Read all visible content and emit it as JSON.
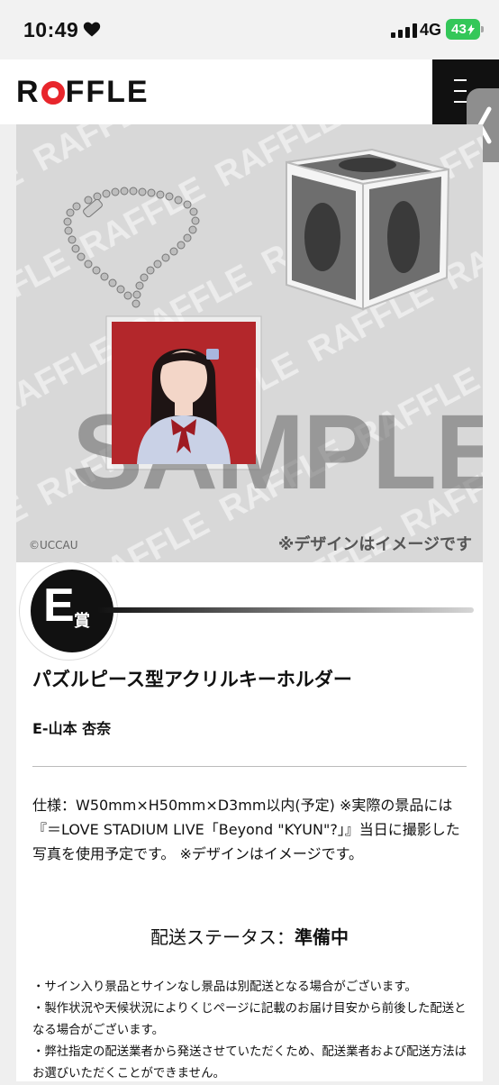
{
  "status_bar": {
    "time": "10:49",
    "network": "4G",
    "battery": "43"
  },
  "header": {
    "logo_before": "R",
    "logo_after": "FFLE"
  },
  "hero": {
    "watermark_text": "SAMPLE",
    "background_word": "RAFFLE",
    "copyright": "©UCCAU",
    "image_note": "※デザインはイメージです"
  },
  "prize": {
    "grade_letter": "E",
    "grade_suffix": "賞",
    "title": "パズルピース型アクリルキーホルダー",
    "member": "E-山本 杏奈",
    "spec": "仕様：W50mm×H50mm×D3mm以内(予定) ※実際の景品には『＝LOVE STADIUM LIVE「Beyond \"KYUN\"?」』当日に撮影した写真を使用予定です。 ※デザインはイメージです。",
    "shipping_label": "配送ステータス：",
    "shipping_value": "準備中",
    "notes": [
      "・サイン入り景品とサインなし景品は別配送となる場合がございます。",
      "・製作状況や天候状況によりくじページに記載のお届け目安から前後した配送となる場合がございます。",
      "・弊社指定の配送業者から発送させていただくため、配送業者および配送方法はお選びいただくことができません。"
    ]
  },
  "colors": {
    "brand_red": "#e8262c",
    "photo_red": "#b3272b",
    "battery_green": "#34c759"
  }
}
